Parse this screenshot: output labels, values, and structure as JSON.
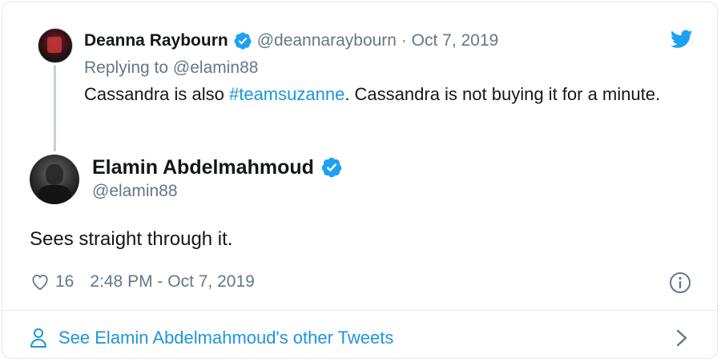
{
  "colors": {
    "accent": "#1b95e0",
    "muted": "#657786",
    "text": "#14171a",
    "border": "#e1e8ed",
    "verified": "#1da1f2"
  },
  "icons": [
    "twitter-bird-icon",
    "verified-badge-icon",
    "heart-icon",
    "info-icon",
    "person-icon",
    "chevron-right-icon"
  ],
  "parent": {
    "name": "Deanna Raybourn",
    "handle": "@deannaraybourn",
    "separator": " · ",
    "date": "Oct 7, 2019",
    "replying_prefix": "Replying to ",
    "replying_handle": "@elamin88",
    "text_before": "Cassandra is also ",
    "hashtag": "#teamsuzanne",
    "text_after": ". Cassandra is not buying it for a minute."
  },
  "tweet": {
    "name": "Elamin Abdelmahmoud",
    "handle": "@elamin88",
    "text": "Sees straight through it.",
    "likes": "16",
    "timestamp": "2:48 PM - Oct 7, 2019"
  },
  "footer": {
    "link_text": "See Elamin Abdelmahmoud's other Tweets"
  }
}
